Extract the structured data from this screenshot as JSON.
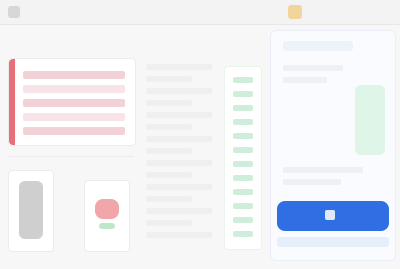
{
  "header": {
    "title": ""
  },
  "actions": {
    "primary_label": ""
  },
  "colors": {
    "accent": "#2f6fe3",
    "danger": "#e86f79",
    "success": "#cfeeda"
  }
}
